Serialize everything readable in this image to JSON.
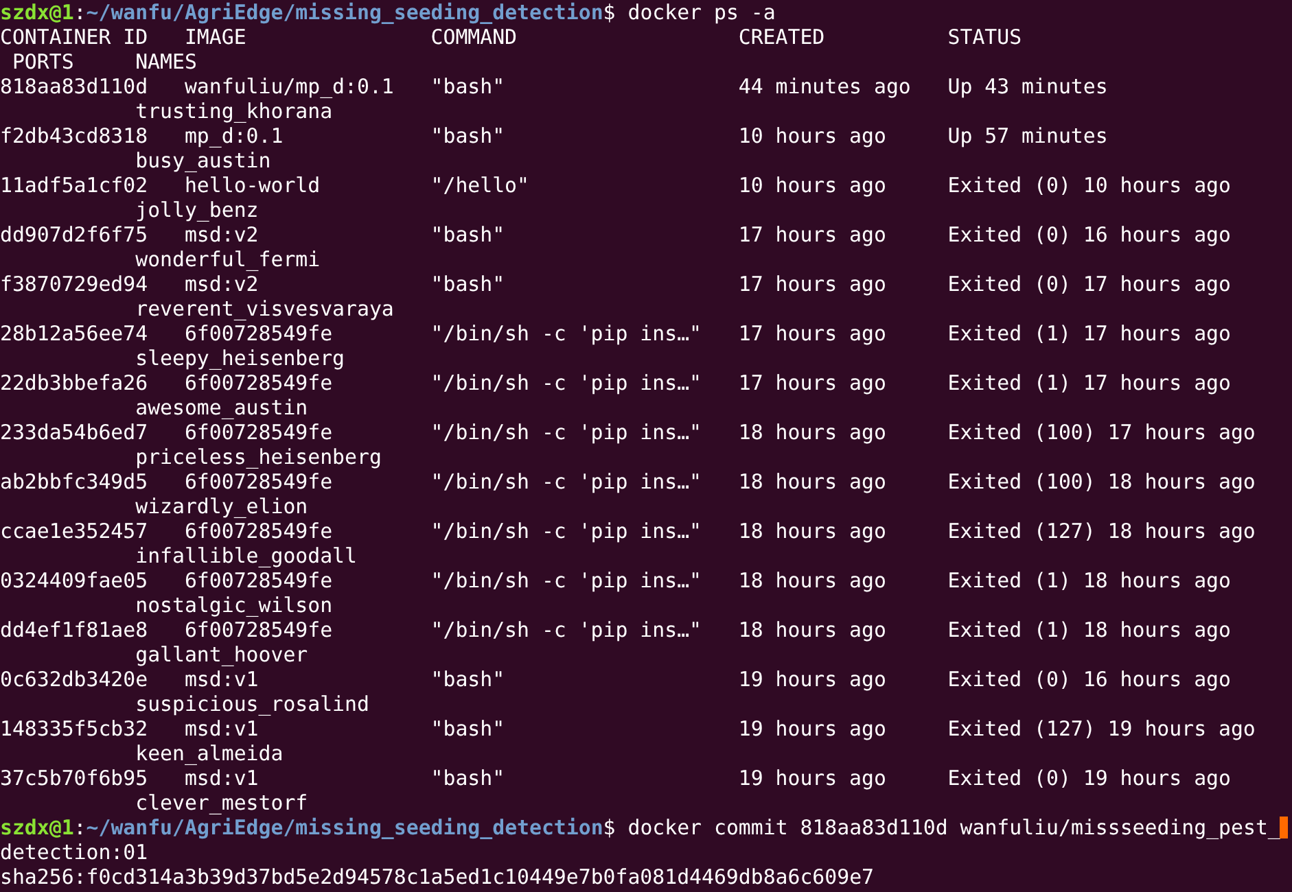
{
  "prompts": [
    {
      "user": "szdx@1",
      "separator": ":",
      "path": "~/wanfu/AgriEdge/missing_seeding_detection",
      "symbol": "$",
      "command": "docker ps -a"
    },
    {
      "user": "szdx@1",
      "separator": ":",
      "path": "~/wanfu/AgriEdge/missing_seeding_detection",
      "symbol": "$",
      "command": "docker commit 818aa83d110d wanfuliu/missseeding_pest_",
      "command_continued": "detection:01",
      "cursor": true
    }
  ],
  "table": {
    "columns": [
      "CONTAINER ID",
      "IMAGE",
      "COMMAND",
      "CREATED",
      "STATUS",
      "PORTS",
      "NAMES"
    ],
    "rows": [
      {
        "id": "818aa83d110d",
        "image": "wanfuliu/mp_d:0.1",
        "command": "\"bash\"",
        "created": "44 minutes ago",
        "status": "Up 43 minutes",
        "name": "trusting_khorana"
      },
      {
        "id": "f2db43cd8318",
        "image": "mp_d:0.1",
        "command": "\"bash\"",
        "created": "10 hours ago",
        "status": "Up 57 minutes",
        "name": "busy_austin"
      },
      {
        "id": "11adf5a1cf02",
        "image": "hello-world",
        "command": "\"/hello\"",
        "created": "10 hours ago",
        "status": "Exited (0) 10 hours ago",
        "name": "jolly_benz"
      },
      {
        "id": "dd907d2f6f75",
        "image": "msd:v2",
        "command": "\"bash\"",
        "created": "17 hours ago",
        "status": "Exited (0) 16 hours ago",
        "name": "wonderful_fermi"
      },
      {
        "id": "f3870729ed94",
        "image": "msd:v2",
        "command": "\"bash\"",
        "created": "17 hours ago",
        "status": "Exited (0) 17 hours ago",
        "name": "reverent_visvesvaraya"
      },
      {
        "id": "28b12a56ee74",
        "image": "6f00728549fe",
        "command": "\"/bin/sh -c 'pip ins…\"",
        "created": "17 hours ago",
        "status": "Exited (1) 17 hours ago",
        "name": "sleepy_heisenberg"
      },
      {
        "id": "22db3bbefa26",
        "image": "6f00728549fe",
        "command": "\"/bin/sh -c 'pip ins…\"",
        "created": "17 hours ago",
        "status": "Exited (1) 17 hours ago",
        "name": "awesome_austin"
      },
      {
        "id": "233da54b6ed7",
        "image": "6f00728549fe",
        "command": "\"/bin/sh -c 'pip ins…\"",
        "created": "18 hours ago",
        "status": "Exited (100) 17 hours ago",
        "name": "priceless_heisenberg"
      },
      {
        "id": "ab2bbfc349d5",
        "image": "6f00728549fe",
        "command": "\"/bin/sh -c 'pip ins…\"",
        "created": "18 hours ago",
        "status": "Exited (100) 18 hours ago",
        "name": "wizardly_elion"
      },
      {
        "id": "ccae1e352457",
        "image": "6f00728549fe",
        "command": "\"/bin/sh -c 'pip ins…\"",
        "created": "18 hours ago",
        "status": "Exited (127) 18 hours ago",
        "name": "infallible_goodall"
      },
      {
        "id": "0324409fae05",
        "image": "6f00728549fe",
        "command": "\"/bin/sh -c 'pip ins…\"",
        "created": "18 hours ago",
        "status": "Exited (1) 18 hours ago",
        "name": "nostalgic_wilson"
      },
      {
        "id": "dd4ef1f81ae8",
        "image": "6f00728549fe",
        "command": "\"/bin/sh -c 'pip ins…\"",
        "created": "18 hours ago",
        "status": "Exited (1) 18 hours ago",
        "name": "gallant_hoover"
      },
      {
        "id": "0c632db3420e",
        "image": "msd:v1",
        "command": "\"bash\"",
        "created": "19 hours ago",
        "status": "Exited (0) 16 hours ago",
        "name": "suspicious_rosalind"
      },
      {
        "id": "148335f5cb32",
        "image": "msd:v1",
        "command": "\"bash\"",
        "created": "19 hours ago",
        "status": "Exited (127) 19 hours ago",
        "name": "keen_almeida"
      },
      {
        "id": "37c5b70f6b95",
        "image": "msd:v1",
        "command": "\"bash\"",
        "created": "19 hours ago",
        "status": "Exited (0) 19 hours ago",
        "name": "clever_mestorf"
      }
    ]
  },
  "output": "sha256:f0cd314a3b39d37bd5e2d94578c1a5ed1c10449e7b0fa081d4469db8a6c609e7"
}
